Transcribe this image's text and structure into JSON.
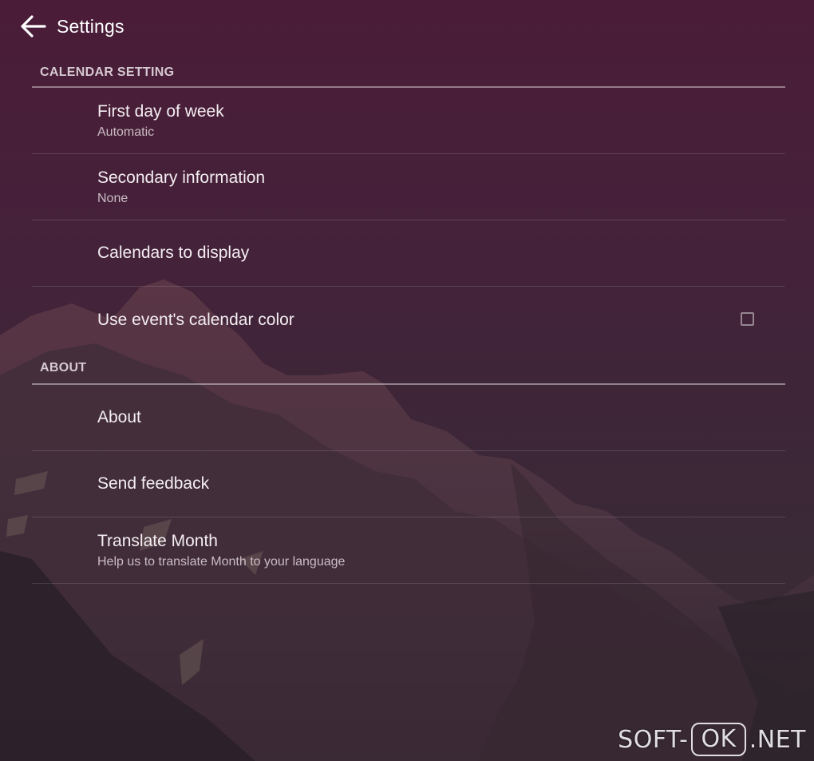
{
  "header": {
    "title": "Settings",
    "back_icon": "arrow-left-icon"
  },
  "sections": {
    "calendar": {
      "title": "CALENDAR SETTING",
      "items": [
        {
          "label": "First day of week",
          "sub": "Automatic"
        },
        {
          "label": "Secondary information",
          "sub": "None"
        },
        {
          "label": "Calendars to display"
        },
        {
          "label": "Use event's calendar color",
          "checked": false
        }
      ]
    },
    "about": {
      "title": "ABOUT",
      "items": [
        {
          "label": "About"
        },
        {
          "label": "Send feedback"
        },
        {
          "label": "Translate Month",
          "sub": "Help us to translate Month to your language"
        }
      ]
    }
  },
  "watermark": {
    "prefix": "SOFT-",
    "boxed": "OK",
    "suffix": ".NET"
  },
  "colors": {
    "background_top": "#4a1c37",
    "background_bottom": "#33262f",
    "mountain": "#4e3340",
    "divider": "#ffffff",
    "section_title": "#d6c9d1"
  }
}
